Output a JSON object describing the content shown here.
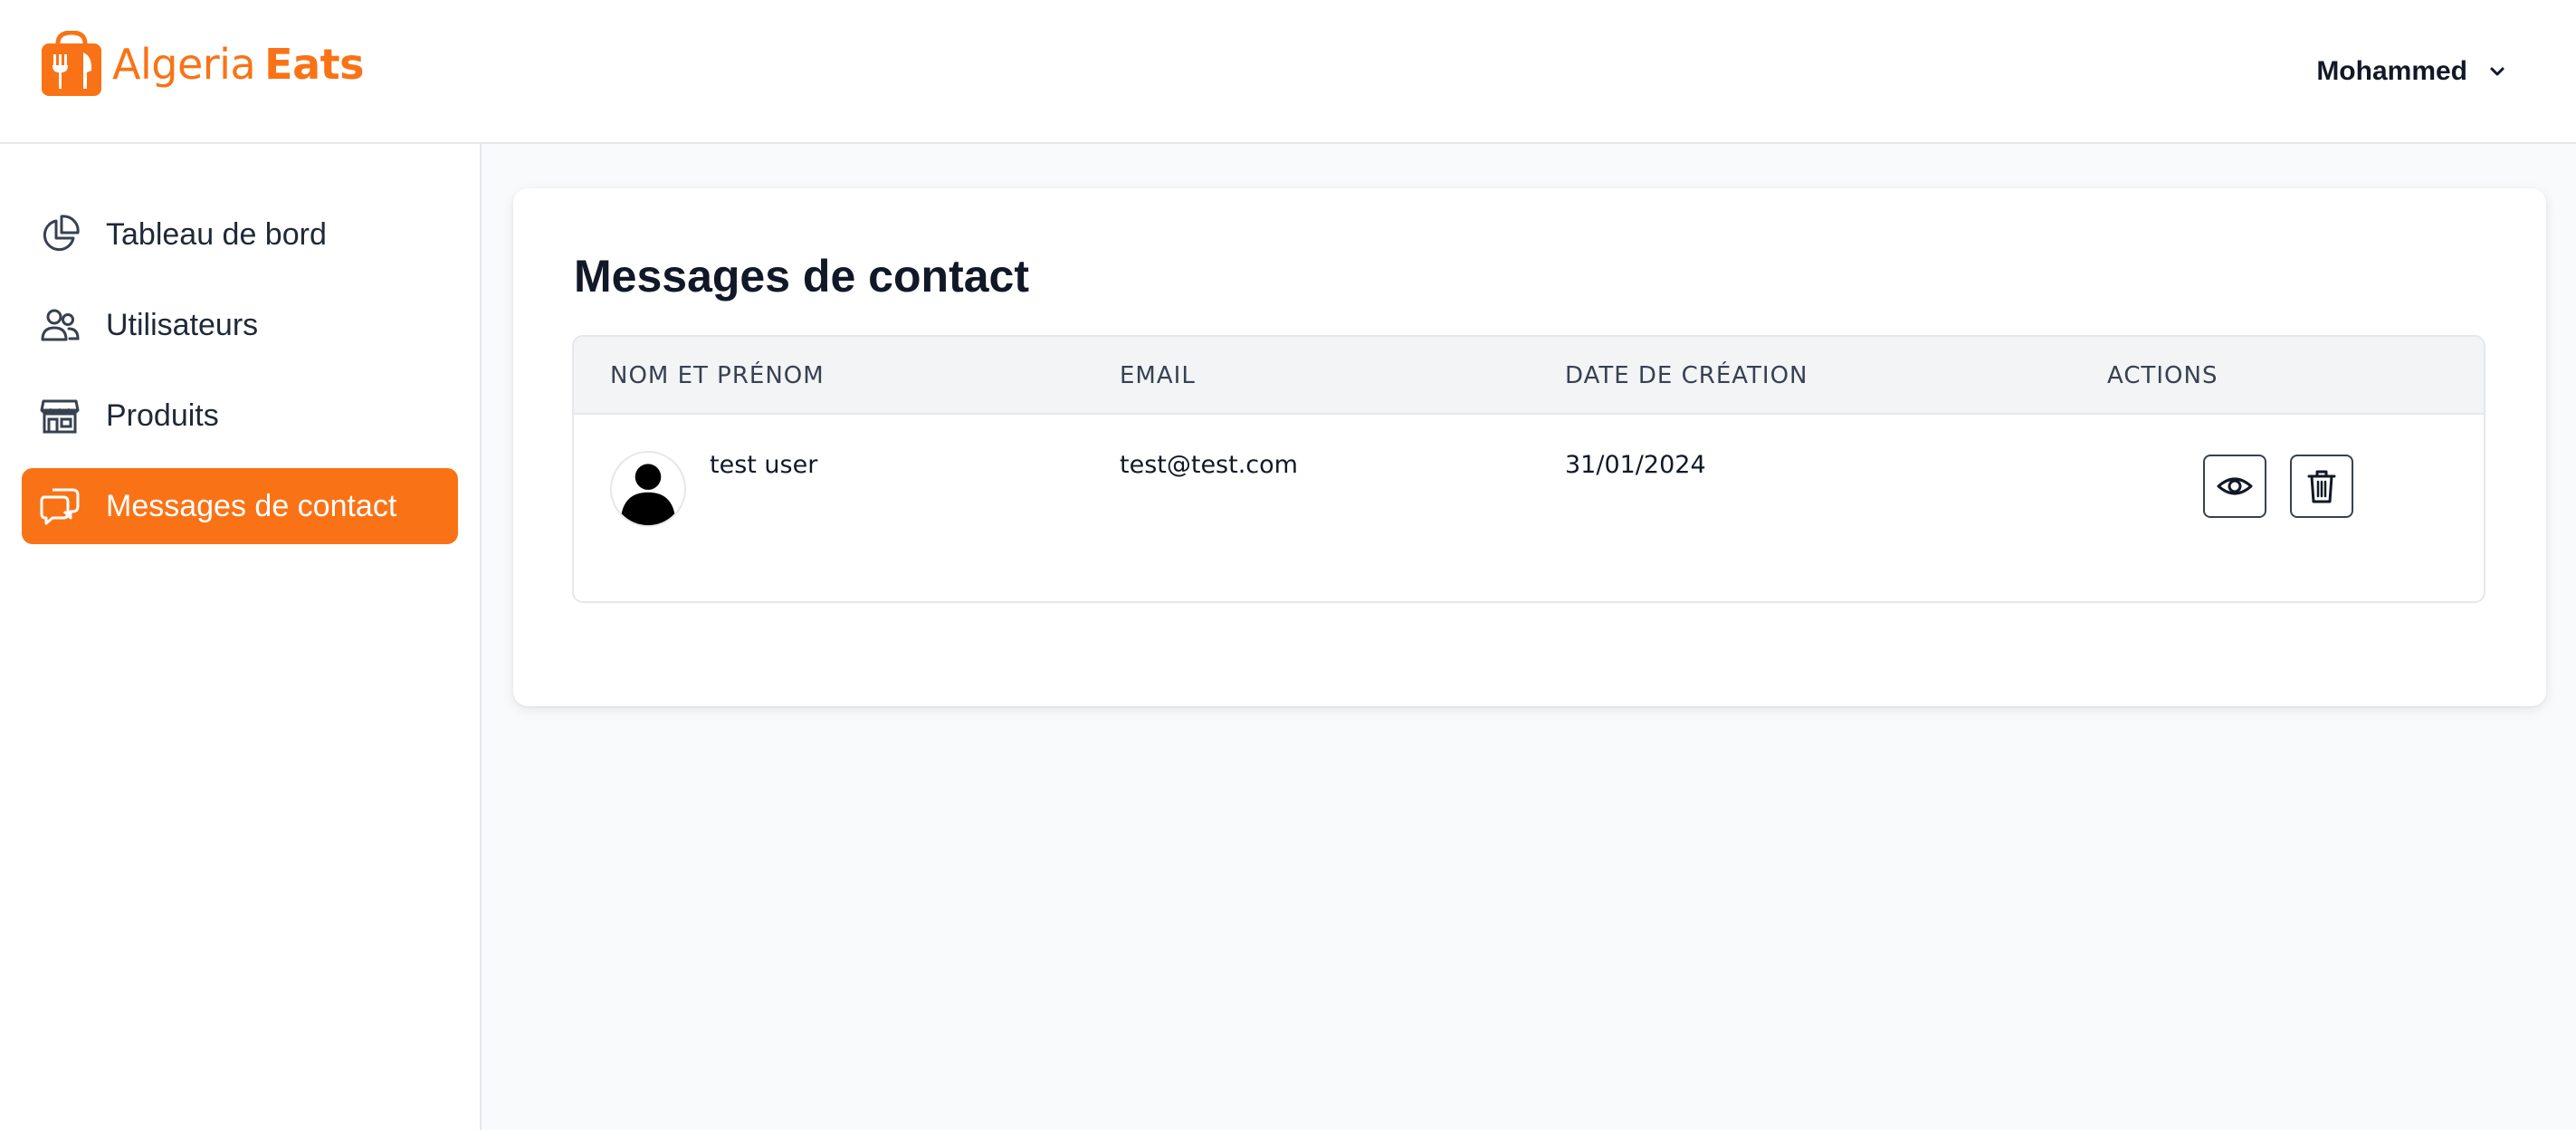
{
  "header": {
    "logo": {
      "word1": "Algeria",
      "word2": "Eats",
      "icon": "fork-knife-bag-icon"
    },
    "user": {
      "name": "Mohammed",
      "icon": "chevron-down-icon"
    }
  },
  "sidebar": {
    "items": [
      {
        "label": "Tableau de bord",
        "icon": "pie-chart-icon",
        "active": false
      },
      {
        "label": "Utilisateurs",
        "icon": "users-icon",
        "active": false
      },
      {
        "label": "Produits",
        "icon": "store-icon",
        "active": false
      },
      {
        "label": "Messages de contact",
        "icon": "chat-bubbles-icon",
        "active": true
      }
    ]
  },
  "main": {
    "title": "Messages de contact",
    "table": {
      "columns": [
        "NOM ET PRÉNOM",
        "EMAIL",
        "DATE DE CRÉATION",
        "ACTIONS"
      ],
      "rows": [
        {
          "name": "test user",
          "email": "test@test.com",
          "date": "31/01/2024",
          "actions": [
            {
              "icon": "eye-icon"
            },
            {
              "icon": "trash-icon"
            }
          ]
        }
      ]
    }
  },
  "colors": {
    "accent": "#f97316",
    "page_background": "#f9fafb",
    "text": "#111827"
  }
}
